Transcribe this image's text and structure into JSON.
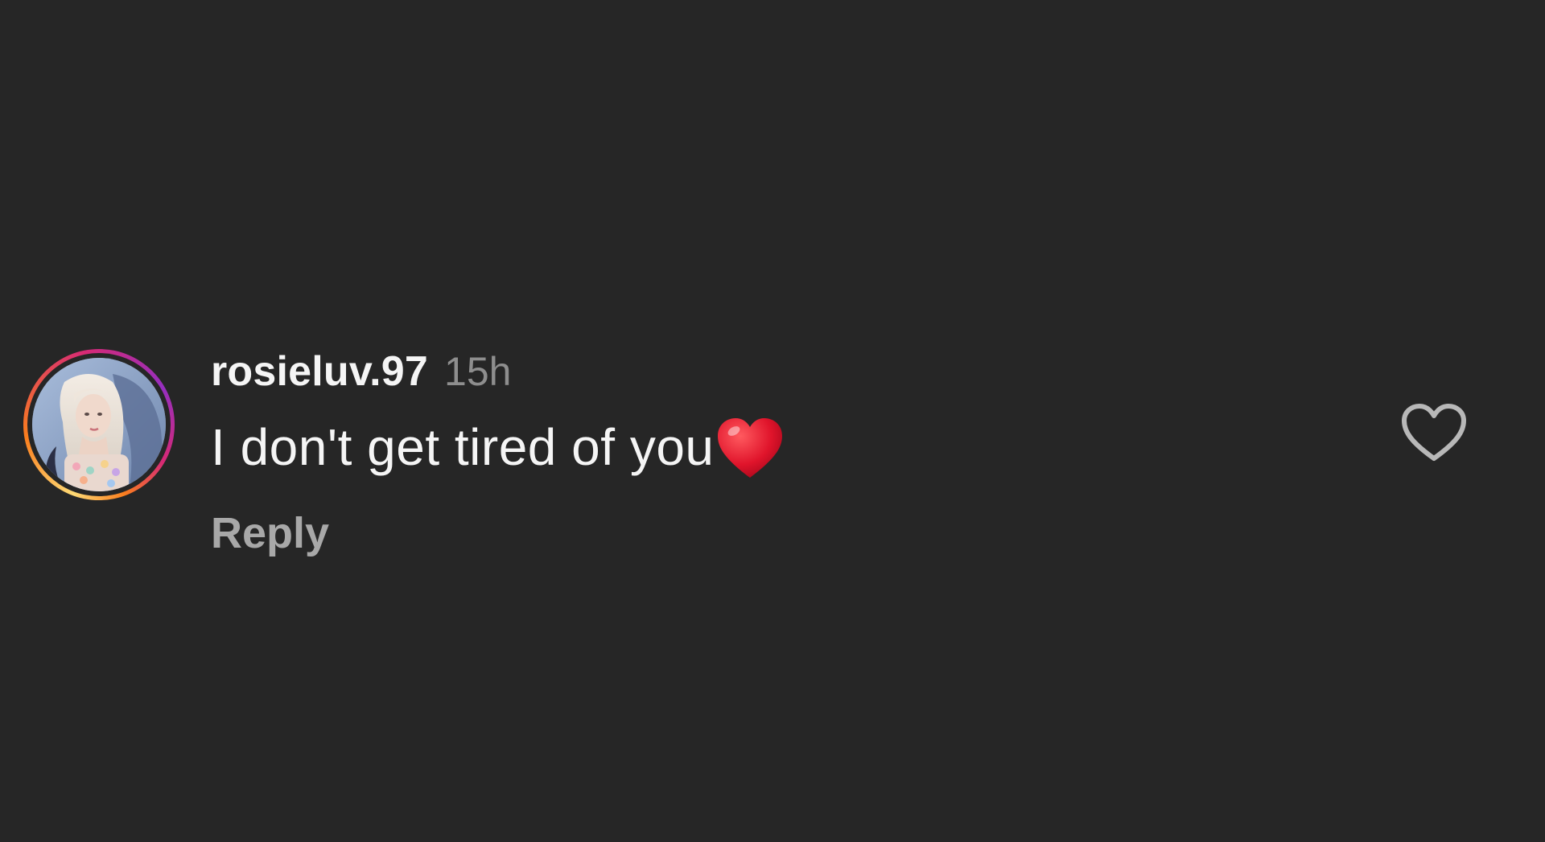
{
  "comment": {
    "username": "rosieluv.97",
    "timestamp": "15h",
    "text": "I don't get tired of you",
    "emoji": "red-heart-emoji",
    "reply_label": "Reply",
    "like_icon": "heart-outline-icon"
  },
  "colors": {
    "background": "#262626",
    "primary_text": "#f5f5f5",
    "secondary_text": "#8e8e8e",
    "reply_text": "#a8a8a8",
    "heart_emoji": "#e0142b"
  }
}
